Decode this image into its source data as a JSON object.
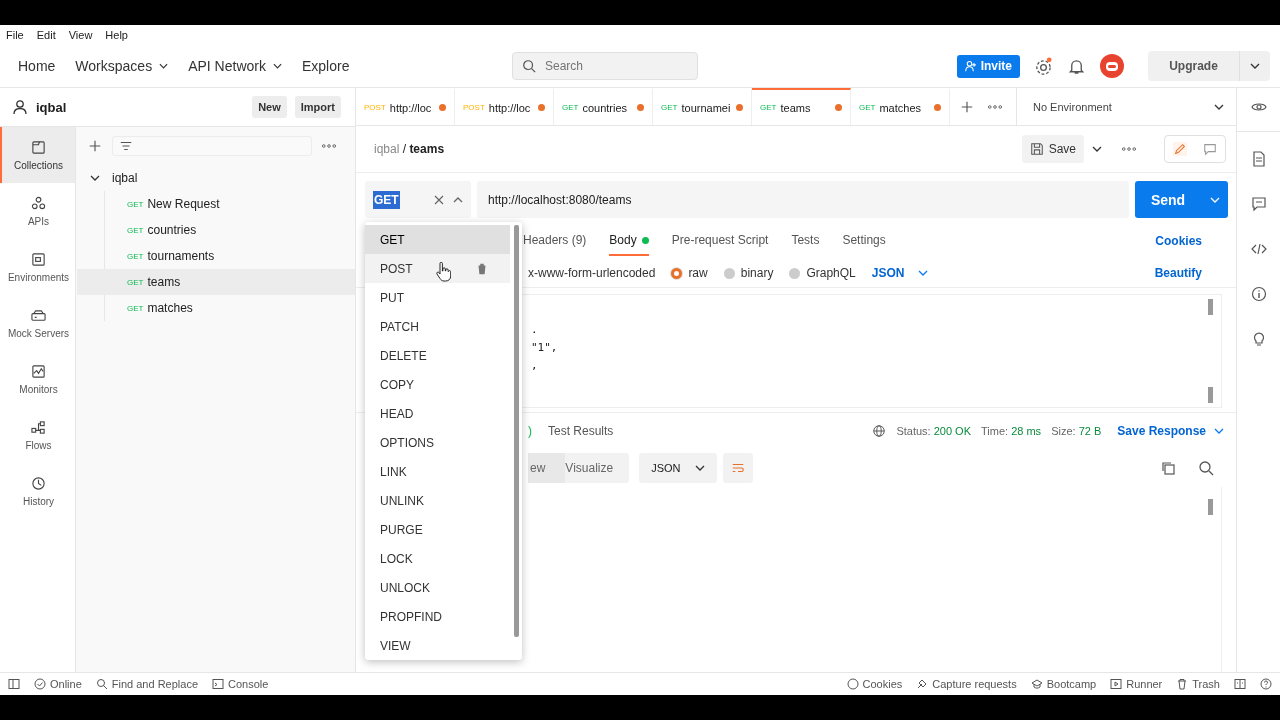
{
  "menu": [
    "File",
    "Edit",
    "View",
    "Help"
  ],
  "nav": [
    {
      "label": "Home",
      "caret": false
    },
    {
      "label": "Workspaces",
      "caret": true
    },
    {
      "label": "API Network",
      "caret": true
    },
    {
      "label": "Explore",
      "caret": false
    }
  ],
  "search": {
    "placeholder": "Search"
  },
  "invite": "Invite",
  "upgrade": "Upgrade",
  "workspace": {
    "name": "iqbal",
    "new": "New",
    "import": "Import"
  },
  "sidebar": [
    {
      "label": "Collections",
      "selected": true
    },
    {
      "label": "APIs",
      "selected": false
    },
    {
      "label": "Environments",
      "selected": false
    },
    {
      "label": "Mock Servers",
      "selected": false
    },
    {
      "label": "Monitors",
      "selected": false
    },
    {
      "label": "Flows",
      "selected": false
    },
    {
      "label": "History",
      "selected": false
    }
  ],
  "tree": {
    "name": "iqbal",
    "expanded": true,
    "children": [
      {
        "method": "GET",
        "name": "New Request",
        "selected": false
      },
      {
        "method": "GET",
        "name": "countries",
        "selected": false
      },
      {
        "method": "GET",
        "name": "tournaments",
        "selected": false
      },
      {
        "method": "GET",
        "name": "teams",
        "selected": true
      },
      {
        "method": "GET",
        "name": "matches",
        "selected": false
      }
    ]
  },
  "tabs": [
    {
      "method": "POST",
      "label": "http://loc",
      "unsaved": true,
      "selected": false
    },
    {
      "method": "POST",
      "label": "http://loc",
      "unsaved": true,
      "selected": false
    },
    {
      "method": "GET",
      "label": "countries",
      "unsaved": true,
      "selected": false
    },
    {
      "method": "GET",
      "label": "tournamei",
      "unsaved": true,
      "selected": false
    },
    {
      "method": "GET",
      "label": "teams",
      "unsaved": true,
      "selected": true
    },
    {
      "method": "GET",
      "label": "matches",
      "unsaved": true,
      "selected": false
    }
  ],
  "environment": "No Environment",
  "breadcrumb": {
    "parent": "iqbal",
    "separator": "/",
    "current": "teams"
  },
  "mode_toggle": [
    {
      "kind": "edit",
      "selected": true
    },
    {
      "kind": "comment",
      "selected": false
    }
  ],
  "save": "Save",
  "request": {
    "method": "GET",
    "url": "http://localhost:8080/teams",
    "send": "Send"
  },
  "method_menu": [
    {
      "label": "GET",
      "selected": true,
      "hovered": false
    },
    {
      "label": "POST",
      "selected": false,
      "hovered": true
    },
    {
      "label": "PUT",
      "selected": false,
      "hovered": false
    },
    {
      "label": "PATCH",
      "selected": false,
      "hovered": false
    },
    {
      "label": "DELETE",
      "selected": false,
      "hovered": false
    },
    {
      "label": "COPY",
      "selected": false,
      "hovered": false
    },
    {
      "label": "HEAD",
      "selected": false,
      "hovered": false
    },
    {
      "label": "OPTIONS",
      "selected": false,
      "hovered": false
    },
    {
      "label": "LINK",
      "selected": false,
      "hovered": false
    },
    {
      "label": "UNLINK",
      "selected": false,
      "hovered": false
    },
    {
      "label": "PURGE",
      "selected": false,
      "hovered": false
    },
    {
      "label": "LOCK",
      "selected": false,
      "hovered": false
    },
    {
      "label": "UNLOCK",
      "selected": false,
      "hovered": false
    },
    {
      "label": "PROPFIND",
      "selected": false,
      "hovered": false
    },
    {
      "label": "VIEW",
      "selected": false,
      "hovered": false
    }
  ],
  "request_tabs": [
    {
      "label": "Headers (9)",
      "selected": false,
      "dot": false
    },
    {
      "label": "Body",
      "selected": true,
      "dot": true
    },
    {
      "label": "Pre-request Script",
      "selected": false,
      "dot": false
    },
    {
      "label": "Tests",
      "selected": false,
      "dot": false
    },
    {
      "label": "Settings",
      "selected": false,
      "dot": false
    }
  ],
  "cookies": "Cookies",
  "body_type_partial": "x-www-form-urlencoded",
  "body_types": [
    {
      "label": "raw",
      "selected": true
    },
    {
      "label": "binary",
      "selected": false
    },
    {
      "label": "GraphQL",
      "selected": false
    }
  ],
  "body_format": "JSON",
  "beautify": "Beautify",
  "code_lines": [
    ".",
    "\"1\",",
    ","
  ],
  "response_tabs": [
    ")",
    "Test Results"
  ],
  "status": {
    "status_label": "Status:",
    "status": "200 OK",
    "time_label": "Time:",
    "time": "28 ms",
    "size_label": "Size:",
    "size": "72 B"
  },
  "save_response": "Save Response",
  "views": [
    {
      "label": "ew",
      "selected": true
    },
    {
      "label": "Visualize",
      "selected": false
    }
  ],
  "response_format": "JSON",
  "status_bar": {
    "left": [
      {
        "kind": "online",
        "label": "Online"
      },
      {
        "kind": "find",
        "label": "Find and Replace"
      },
      {
        "kind": "console",
        "label": "Console"
      }
    ],
    "right": [
      {
        "kind": "cookies",
        "label": "Cookies"
      },
      {
        "kind": "capture",
        "label": "Capture requests"
      },
      {
        "kind": "bootcamp",
        "label": "Bootcamp"
      },
      {
        "kind": "runner",
        "label": "Runner"
      },
      {
        "kind": "trash",
        "label": "Trash"
      }
    ]
  }
}
